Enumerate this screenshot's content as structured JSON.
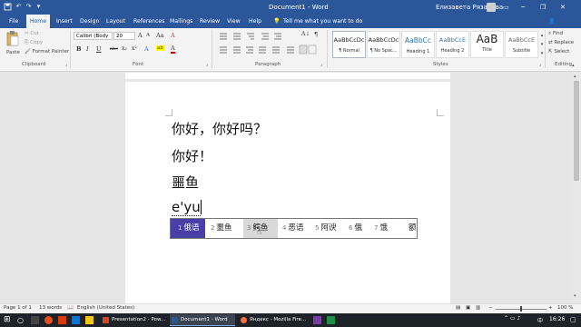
{
  "window": {
    "title": "Document1 - Word",
    "user": "Елизавета Рязанова",
    "min": "─",
    "restore": "❐",
    "close": "✕"
  },
  "ribbon_tabs": [
    "File",
    "Home",
    "Insert",
    "Design",
    "Layout",
    "References",
    "Mailings",
    "Review",
    "View",
    "Help"
  ],
  "tell_me": "Tell me what you want to do",
  "clipboard": {
    "paste": "Paste",
    "cut": "Cut",
    "copy": "Copy",
    "format_painter": "Format Painter",
    "group": "Clipboard"
  },
  "font": {
    "name": "Calibri (Body",
    "size": "20",
    "group": "Font",
    "bold": "B",
    "italic": "I",
    "underline": "U",
    "strike": "abc",
    "sub": "x₂",
    "sup": "x²",
    "grow": "A",
    "shrink": "A",
    "case": "Aa",
    "clear": "A",
    "effects": "A",
    "highlight": "ab",
    "color": "A"
  },
  "paragraph": {
    "group": "Paragraph",
    "pilcrow": "¶"
  },
  "styles": {
    "group": "Styles",
    "items": [
      {
        "preview": "AaBbCcDc",
        "name": "¶ Normal"
      },
      {
        "preview": "AaBbCcDc",
        "name": "¶ No Spac..."
      },
      {
        "preview": "AaBbCc",
        "name": "Heading 1"
      },
      {
        "preview": "AaBbCcE",
        "name": "Heading 2"
      },
      {
        "preview": "AaB",
        "name": "Title"
      },
      {
        "preview": "AaBbCcE",
        "name": "Subtitle"
      }
    ]
  },
  "editing": {
    "find": "Find",
    "replace": "Replace",
    "select": "Select",
    "group": "Editing"
  },
  "document": {
    "lines": [
      "你好，你好吗？",
      "你好！",
      "噩鱼",
      "e'yu"
    ]
  },
  "ime": {
    "candidates": [
      {
        "num": "1",
        "text": "俄语",
        "selected": true
      },
      {
        "num": "2",
        "text": "噩鱼",
        "selected": false
      },
      {
        "num": "3",
        "text": "鳄鱼",
        "selected": false
      },
      {
        "num": "4",
        "text": "恶语",
        "selected": false
      },
      {
        "num": "5",
        "text": "阿谀",
        "selected": false
      },
      {
        "num": "6",
        "text": "俄",
        "selected": false
      },
      {
        "num": "7",
        "text": "饿",
        "selected": false
      },
      {
        "num": "",
        "text": "额",
        "selected": false
      }
    ],
    "highlight_color": "#4a3fa8",
    "hover_color": "#d8d8d8"
  },
  "status": {
    "page": "Page 1 of 1",
    "words": "13 words",
    "language": "English (United States)",
    "zoom": "100 %"
  },
  "taskbar": {
    "items": [
      {
        "label": "Presentation2 - Pow..."
      },
      {
        "label": "Document1 - Word"
      },
      {
        "label": "Яндекс - Mozilla Fire..."
      }
    ],
    "time": "16:26"
  },
  "colors": {
    "word_blue": "#2b579a",
    "ribbon": "#f3f3f3",
    "taskbar": "#1e2329"
  }
}
